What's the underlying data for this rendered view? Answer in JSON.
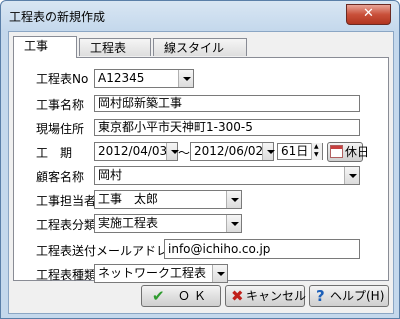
{
  "window": {
    "title": "工程表の新規作成",
    "close_label": "✕"
  },
  "tabs": [
    {
      "label": "工事"
    },
    {
      "label": "工程表"
    },
    {
      "label": "線スタイル"
    }
  ],
  "form": {
    "koutei_no": {
      "label": "工程表No",
      "value": "A12345"
    },
    "kouji_name": {
      "label": "工事名称",
      "value": "岡村邸新築工事"
    },
    "site_address": {
      "label": "現場住所",
      "value": "東京都小平市天神町1-300-5"
    },
    "period": {
      "label": "工　期",
      "start": "2012/04/03",
      "separator": "～",
      "end": "2012/06/02",
      "days": "61日",
      "holiday_button": "休日"
    },
    "customer": {
      "label": "顧客名称",
      "value": "岡村"
    },
    "person": {
      "label": "工事担当者",
      "value": "工事　太郎"
    },
    "category": {
      "label": "工程表分類",
      "value": "実施工程表"
    },
    "mail": {
      "label": "工程表送付メールアドレス",
      "value": "info@ichiho.co.jp"
    },
    "type": {
      "label": "工程表種類",
      "value": "ネットワーク工程表"
    }
  },
  "buttons": {
    "ok": {
      "label": "Ｏ Ｋ"
    },
    "cancel": {
      "label": "キャンセル"
    },
    "help": {
      "label": "ヘルプ(H)"
    }
  },
  "colors": {
    "ok_icon": "#2e9b2e",
    "cancel_icon": "#c0201a",
    "help_icon": "#1c5fb8"
  }
}
